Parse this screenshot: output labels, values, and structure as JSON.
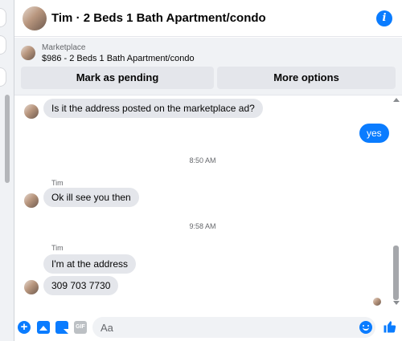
{
  "header": {
    "title": "Tim · 2 Beds 1 Bath Apartment/condo",
    "info_icon": "info-icon",
    "accent": "#0a7cff"
  },
  "marketplace": {
    "label": "Marketplace",
    "item": "$986 - 2 Beds 1 Bath Apartment/condo",
    "buttons": {
      "pending": "Mark as pending",
      "more": "More options"
    }
  },
  "messages": {
    "q1": "Is it the address posted on the marketplace ad?",
    "out1": "yes",
    "ts1": "8:50 AM",
    "sender1": "Tim",
    "m2": "Ok ill see you then",
    "ts2": "9:58 AM",
    "sender2": "Tim",
    "m3": "I'm at the address",
    "m4": "309 703 7730"
  },
  "composer": {
    "placeholder": "Aa",
    "icons": [
      "plus-icon",
      "photo-icon",
      "sticker-icon",
      "gif-icon",
      "emoji-icon",
      "thumbs-up-icon"
    ],
    "gif_label": "GIF"
  },
  "colors": {
    "outgoing_bubble": "#0a7cff",
    "incoming_bubble": "#e4e6eb",
    "panel_bg": "#f0f2f5"
  }
}
